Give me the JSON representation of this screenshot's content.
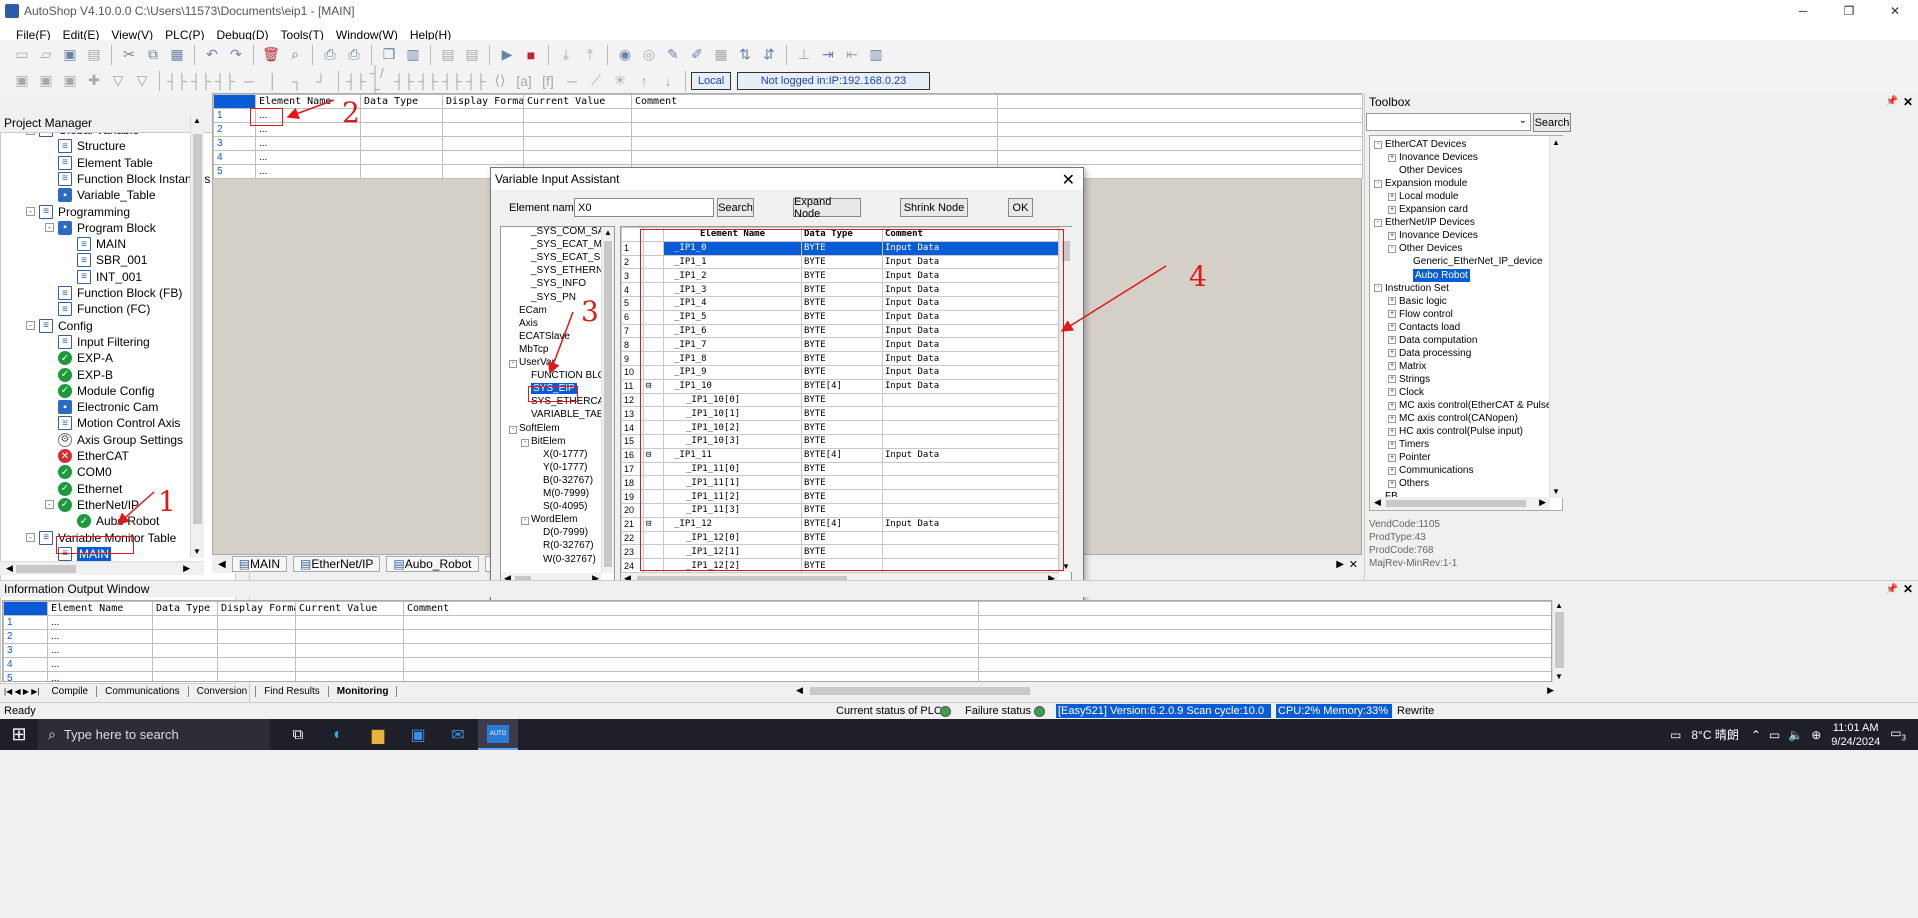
{
  "window": {
    "title": "AutoShop V4.10.0.0  C:\\Users\\11573\\Documents\\eip1 - [MAIN]"
  },
  "menu": [
    "File(F)",
    "Edit(E)",
    "View(V)",
    "PLC(P)",
    "Debug(D)",
    "Tools(T)",
    "Window(W)",
    "Help(H)"
  ],
  "toolbar2": {
    "local_label": "Local",
    "login_status": "Not logged in:IP:192.168.0.23"
  },
  "project_manager": {
    "title": "Project Manager",
    "items": [
      {
        "label": "Global Variable",
        "indent": 1,
        "icon": "doc",
        "exp": "-"
      },
      {
        "label": "Structure",
        "indent": 2,
        "icon": "doc"
      },
      {
        "label": "Element Table",
        "indent": 2,
        "icon": "doc"
      },
      {
        "label": "Function Block Instances",
        "indent": 2,
        "icon": "doc"
      },
      {
        "label": "Variable_Table",
        "indent": 2,
        "icon": "blue"
      },
      {
        "label": "Programming",
        "indent": 1,
        "icon": "doc",
        "exp": "-"
      },
      {
        "label": "Program Block",
        "indent": 2,
        "icon": "blue",
        "exp": "-"
      },
      {
        "label": "MAIN",
        "indent": 3,
        "icon": "doc"
      },
      {
        "label": "SBR_001",
        "indent": 3,
        "icon": "doc"
      },
      {
        "label": "INT_001",
        "indent": 3,
        "icon": "doc"
      },
      {
        "label": "Function Block (FB)",
        "indent": 2,
        "icon": "doc"
      },
      {
        "label": "Function (FC)",
        "indent": 2,
        "icon": "doc"
      },
      {
        "label": "Config",
        "indent": 1,
        "icon": "doc",
        "exp": "-"
      },
      {
        "label": "Input Filtering",
        "indent": 2,
        "icon": "doc"
      },
      {
        "label": "EXP-A",
        "indent": 2,
        "icon": "ok"
      },
      {
        "label": "EXP-B",
        "indent": 2,
        "icon": "ok"
      },
      {
        "label": "Module Config",
        "indent": 2,
        "icon": "ok"
      },
      {
        "label": "Electronic Cam",
        "indent": 2,
        "icon": "blue"
      },
      {
        "label": "Motion Control Axis",
        "indent": 2,
        "icon": "doc"
      },
      {
        "label": "Axis Group Settings",
        "indent": 2,
        "icon": "gear"
      },
      {
        "label": "EtherCAT",
        "indent": 2,
        "icon": "err"
      },
      {
        "label": "COM0",
        "indent": 2,
        "icon": "ok"
      },
      {
        "label": "Ethernet",
        "indent": 2,
        "icon": "ok"
      },
      {
        "label": "EtherNet/IP",
        "indent": 2,
        "icon": "ok",
        "exp": "-"
      },
      {
        "label": "Aubo Robot",
        "indent": 3,
        "icon": "ok"
      },
      {
        "label": "Variable Monitor Table",
        "indent": 1,
        "icon": "doc",
        "exp": "-"
      },
      {
        "label": "MAIN",
        "indent": 2,
        "icon": "doc",
        "selected": true
      }
    ]
  },
  "monitor_table": {
    "columns": [
      "Element Name",
      "Data Type",
      "Display Format",
      "Current Value",
      "Comment"
    ],
    "rows": [
      {
        "n": "1",
        "name": "..."
      },
      {
        "n": "2",
        "name": "..."
      },
      {
        "n": "3",
        "name": "..."
      },
      {
        "n": "4",
        "name": "..."
      },
      {
        "n": "5",
        "name": "..."
      }
    ]
  },
  "editor_tabs": [
    "MAIN",
    "EtherNet/IP",
    "Aubo_Robot",
    "MAIN"
  ],
  "dialog": {
    "title": "Variable Input Assistant",
    "element_name_label": "Element name:",
    "element_name_value": "X0",
    "search": "Search",
    "expand": "Expand Node",
    "shrink": "Shrink Node",
    "ok": "OK",
    "tree": [
      {
        "label": "_SYS_COM_SAV",
        "indent": 2
      },
      {
        "label": "_SYS_ECAT_MA",
        "indent": 2
      },
      {
        "label": "_SYS_ECAT_SL/",
        "indent": 2
      },
      {
        "label": "_SYS_ETHERNE'",
        "indent": 2
      },
      {
        "label": "_SYS_INFO",
        "indent": 2
      },
      {
        "label": "_SYS_PN",
        "indent": 2
      },
      {
        "label": "ECam",
        "indent": 1
      },
      {
        "label": "Axis",
        "indent": 1
      },
      {
        "label": "ECATSlave",
        "indent": 1
      },
      {
        "label": "MbTcp",
        "indent": 1
      },
      {
        "label": "UserVar",
        "indent": 1,
        "exp": "-"
      },
      {
        "label": "FUNCTION BLOC",
        "indent": 2
      },
      {
        "label": "SYS_EIP",
        "indent": 2,
        "selected": true
      },
      {
        "label": "SYS_ETHERCAT",
        "indent": 2
      },
      {
        "label": "VARIABLE_TABL",
        "indent": 2
      },
      {
        "label": "SoftElem",
        "indent": 1,
        "exp": "-"
      },
      {
        "label": "BitElem",
        "indent": 2,
        "exp": "-"
      },
      {
        "label": "X(0-1777)",
        "indent": 3
      },
      {
        "label": "Y(0-1777)",
        "indent": 3
      },
      {
        "label": "B(0-32767)",
        "indent": 3
      },
      {
        "label": "M(0-7999)",
        "indent": 3
      },
      {
        "label": "S(0-4095)",
        "indent": 3
      },
      {
        "label": "WordElem",
        "indent": 2,
        "exp": "-"
      },
      {
        "label": "D(0-7999)",
        "indent": 3
      },
      {
        "label": "R(0-32767)",
        "indent": 3
      },
      {
        "label": "W(0-32767)",
        "indent": 3
      }
    ],
    "grid_columns": [
      "Element Name",
      "Data Type",
      "Comment"
    ],
    "grid_rows": [
      {
        "n": "1",
        "name": "_IP1_0",
        "type": "BYTE",
        "comment": "Input Data",
        "hl": true
      },
      {
        "n": "2",
        "name": "_IP1_1",
        "type": "BYTE",
        "comment": "Input Data"
      },
      {
        "n": "3",
        "name": "_IP1_2",
        "type": "BYTE",
        "comment": "Input Data"
      },
      {
        "n": "4",
        "name": "_IP1_3",
        "type": "BYTE",
        "comment": "Input Data"
      },
      {
        "n": "5",
        "name": "_IP1_4",
        "type": "BYTE",
        "comment": "Input Data"
      },
      {
        "n": "6",
        "name": "_IP1_5",
        "type": "BYTE",
        "comment": "Input Data"
      },
      {
        "n": "7",
        "name": "_IP1_6",
        "type": "BYTE",
        "comment": "Input Data"
      },
      {
        "n": "8",
        "name": "_IP1_7",
        "type": "BYTE",
        "comment": "Input Data"
      },
      {
        "n": "9",
        "name": "_IP1_8",
        "type": "BYTE",
        "comment": "Input Data"
      },
      {
        "n": "10",
        "name": "_IP1_9",
        "type": "BYTE",
        "comment": "Input Data"
      },
      {
        "n": "11",
        "name": "_IP1_10",
        "type": "BYTE[4]",
        "comment": "Input Data",
        "exp": "-"
      },
      {
        "n": "12",
        "name": "_IP1_10[0]",
        "type": "BYTE",
        "comment": "",
        "sub": true
      },
      {
        "n": "13",
        "name": "_IP1_10[1]",
        "type": "BYTE",
        "comment": "",
        "sub": true
      },
      {
        "n": "14",
        "name": "_IP1_10[2]",
        "type": "BYTE",
        "comment": "",
        "sub": true
      },
      {
        "n": "15",
        "name": "_IP1_10[3]",
        "type": "BYTE",
        "comment": "",
        "sub": true
      },
      {
        "n": "16",
        "name": "_IP1_11",
        "type": "BYTE[4]",
        "comment": "Input Data",
        "exp": "-"
      },
      {
        "n": "17",
        "name": "_IP1_11[0]",
        "type": "BYTE",
        "comment": "",
        "sub": true
      },
      {
        "n": "18",
        "name": "_IP1_11[1]",
        "type": "BYTE",
        "comment": "",
        "sub": true
      },
      {
        "n": "19",
        "name": "_IP1_11[2]",
        "type": "BYTE",
        "comment": "",
        "sub": true
      },
      {
        "n": "20",
        "name": "_IP1_11[3]",
        "type": "BYTE",
        "comment": "",
        "sub": true
      },
      {
        "n": "21",
        "name": "_IP1_12",
        "type": "BYTE[4]",
        "comment": "Input Data",
        "exp": "-"
      },
      {
        "n": "22",
        "name": "_IP1_12[0]",
        "type": "BYTE",
        "comment": "",
        "sub": true
      },
      {
        "n": "23",
        "name": "_IP1_12[1]",
        "type": "BYTE",
        "comment": "",
        "sub": true
      },
      {
        "n": "24",
        "name": "_IP1_12[2]",
        "type": "BYTE",
        "comment": "",
        "sub": true
      }
    ]
  },
  "toolbox": {
    "title": "Toolbox",
    "search": "Search",
    "tree": [
      {
        "label": "EtherCAT Devices",
        "indent": 0,
        "exp": "-"
      },
      {
        "label": "Inovance Devices",
        "indent": 1,
        "exp": "+"
      },
      {
        "label": "Other Devices",
        "indent": 1
      },
      {
        "label": "Expansion module",
        "indent": 0,
        "exp": "-"
      },
      {
        "label": "Local module",
        "indent": 1,
        "exp": "+"
      },
      {
        "label": "Expansion card",
        "indent": 1,
        "exp": "+"
      },
      {
        "label": "EtherNet/IP Devices",
        "indent": 0,
        "exp": "-"
      },
      {
        "label": "Inovance Devices",
        "indent": 1,
        "exp": "+"
      },
      {
        "label": "Other Devices",
        "indent": 1,
        "exp": "-"
      },
      {
        "label": "Generic_EtherNet_IP_device",
        "indent": 2
      },
      {
        "label": "Aubo Robot",
        "indent": 2,
        "selected": true
      },
      {
        "label": "Instruction Set",
        "indent": 0,
        "exp": "-"
      },
      {
        "label": "Basic logic",
        "indent": 1,
        "exp": "+"
      },
      {
        "label": "Flow control",
        "indent": 1,
        "exp": "+"
      },
      {
        "label": "Contacts load",
        "indent": 1,
        "exp": "+"
      },
      {
        "label": "Data computation",
        "indent": 1,
        "exp": "+"
      },
      {
        "label": "Data processing",
        "indent": 1,
        "exp": "+"
      },
      {
        "label": "Matrix",
        "indent": 1,
        "exp": "+"
      },
      {
        "label": "Strings",
        "indent": 1,
        "exp": "+"
      },
      {
        "label": "Clock",
        "indent": 1,
        "exp": "+"
      },
      {
        "label": "MC axis control(EtherCAT & Pulse outp",
        "indent": 1,
        "exp": "+"
      },
      {
        "label": "MC axis control(CANopen)",
        "indent": 1,
        "exp": "+"
      },
      {
        "label": "HC axis control(Pulse input)",
        "indent": 1,
        "exp": "+"
      },
      {
        "label": "Timers",
        "indent": 1,
        "exp": "+"
      },
      {
        "label": "Pointer",
        "indent": 1,
        "exp": "+"
      },
      {
        "label": "Communications",
        "indent": 1,
        "exp": "+"
      },
      {
        "label": "Others",
        "indent": 1,
        "exp": "+"
      },
      {
        "label": "FB",
        "indent": 0
      }
    ],
    "info": [
      "VendCode:1105",
      "ProdType:43",
      "ProdCode:768",
      "MajRev-MinRev:1-1"
    ]
  },
  "output": {
    "title": "Information Output Window",
    "columns": [
      "Element Name",
      "Data Type",
      "Display Format",
      "Current Value",
      "Comment"
    ],
    "rows": [
      "1",
      "2",
      "3",
      "4",
      "5"
    ],
    "row_value": "...",
    "tabs": [
      "Compile",
      "Communications",
      "Conversion",
      "Find Results",
      "Monitoring"
    ]
  },
  "status": {
    "ready": "Ready",
    "plc_label": "Current status of PLC",
    "failure_label": "Failure status",
    "version": "[Easy521] Version:6.2.0.9 Scan cycle:10.0 ms",
    "cpu": "CPU:2%  Memory:33%",
    "mode": "Rewrite"
  },
  "taskbar": {
    "search_placeholder": "Type here to search",
    "weather": "8°C 晴朗",
    "time": "11:01 AM",
    "date": "9/24/2024",
    "notif": "3"
  },
  "annotations": [
    "1",
    "2",
    "3",
    "4"
  ],
  "colors": {
    "accent": "#0a5cd6",
    "annotation": "#e01818",
    "ok": "#1a9a3a",
    "error": "#d23030"
  }
}
